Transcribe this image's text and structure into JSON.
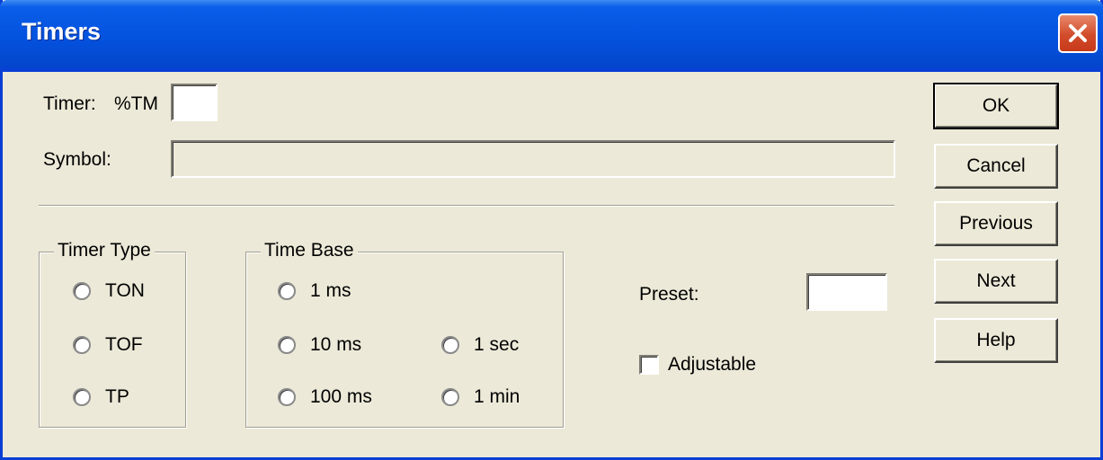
{
  "window": {
    "title": "Timers"
  },
  "timer": {
    "label": "Timer:",
    "prefix": "%TM",
    "value": ""
  },
  "symbol": {
    "label": "Symbol:",
    "value": ""
  },
  "timer_type": {
    "legend": "Timer Type",
    "options": [
      "TON",
      "TOF",
      "TP"
    ]
  },
  "time_base": {
    "legend": "Time Base",
    "options": [
      "1 ms",
      "10 ms",
      "100 ms",
      "1 sec",
      "1 min"
    ]
  },
  "preset": {
    "label": "Preset:",
    "value": ""
  },
  "adjustable": {
    "label": "Adjustable",
    "checked": false
  },
  "buttons": {
    "ok": "OK",
    "cancel": "Cancel",
    "previous": "Previous",
    "next": "Next",
    "help": "Help"
  },
  "colors": {
    "titlebar": "#0453e0",
    "dialog_bg": "#ece9d8",
    "close_button": "#d24c2a"
  }
}
